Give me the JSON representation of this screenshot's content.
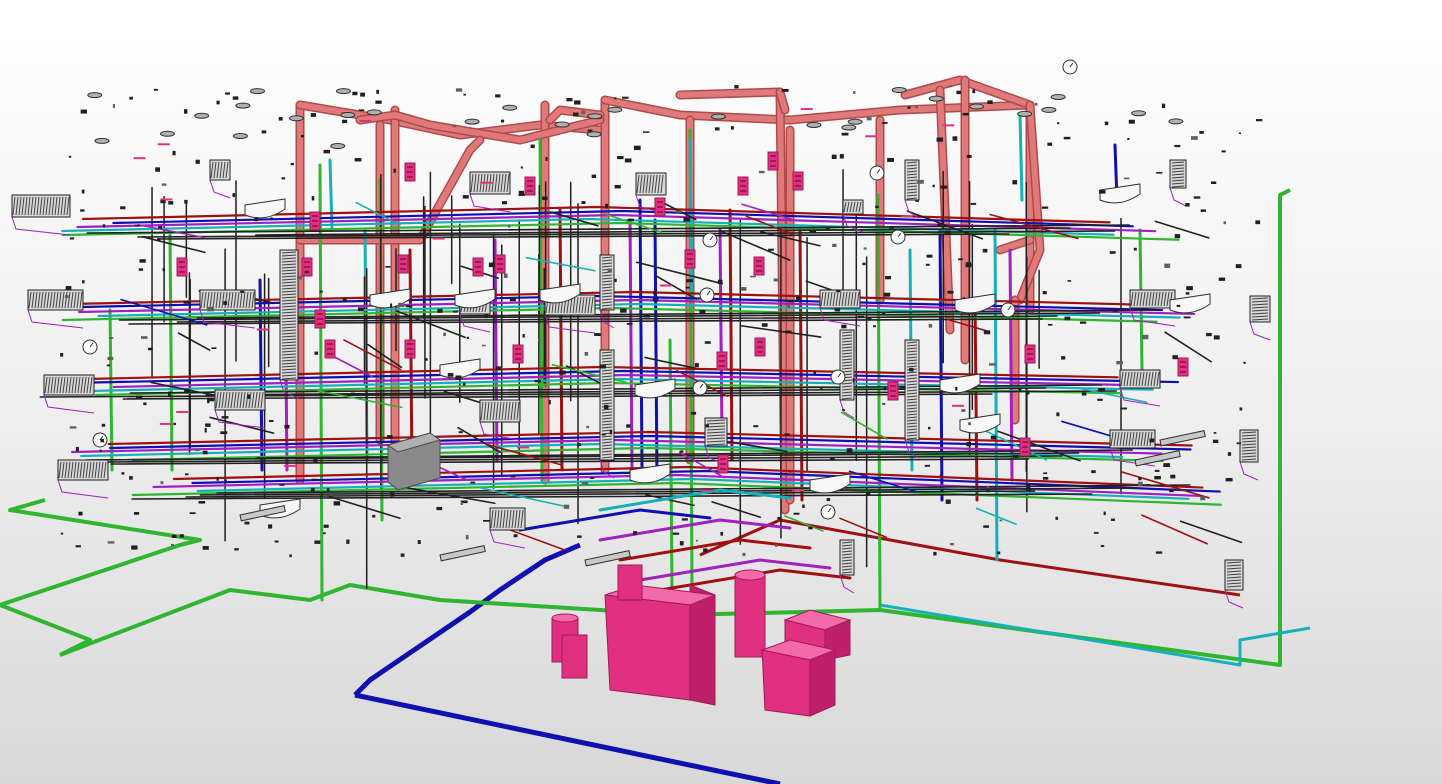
{
  "view": {
    "type": "3D MEP piping model view",
    "background": "#f0f0f0",
    "visible_text": []
  },
  "systems": [
    {
      "id": "drainage-vent",
      "color": "#e07a7a",
      "dark": "#b04a4a",
      "description_shown": false
    },
    {
      "id": "heating-supply",
      "color": "#2fb52f",
      "dark": "#157a15",
      "description_shown": false
    },
    {
      "id": "water-main",
      "color": "#1010b0",
      "dark": "#000070",
      "description_shown": false
    },
    {
      "id": "heating-return",
      "color": "#a01010",
      "dark": "#600808",
      "description_shown": false
    },
    {
      "id": "hot-water",
      "color": "#16b0b8",
      "dark": "#0a7078",
      "description_shown": false
    },
    {
      "id": "circulation",
      "color": "#a020c0",
      "dark": "#60107a",
      "description_shown": false
    },
    {
      "id": "equipment",
      "color": "#e0307f",
      "dark": "#a01a58",
      "description_shown": false
    },
    {
      "id": "radiator",
      "color": "#808080",
      "dark": "#303030",
      "description_shown": false
    }
  ],
  "colors": {
    "pipe_dark": "#202020",
    "fixture_white": "#f8f8f8",
    "grey_box": "#808080"
  }
}
